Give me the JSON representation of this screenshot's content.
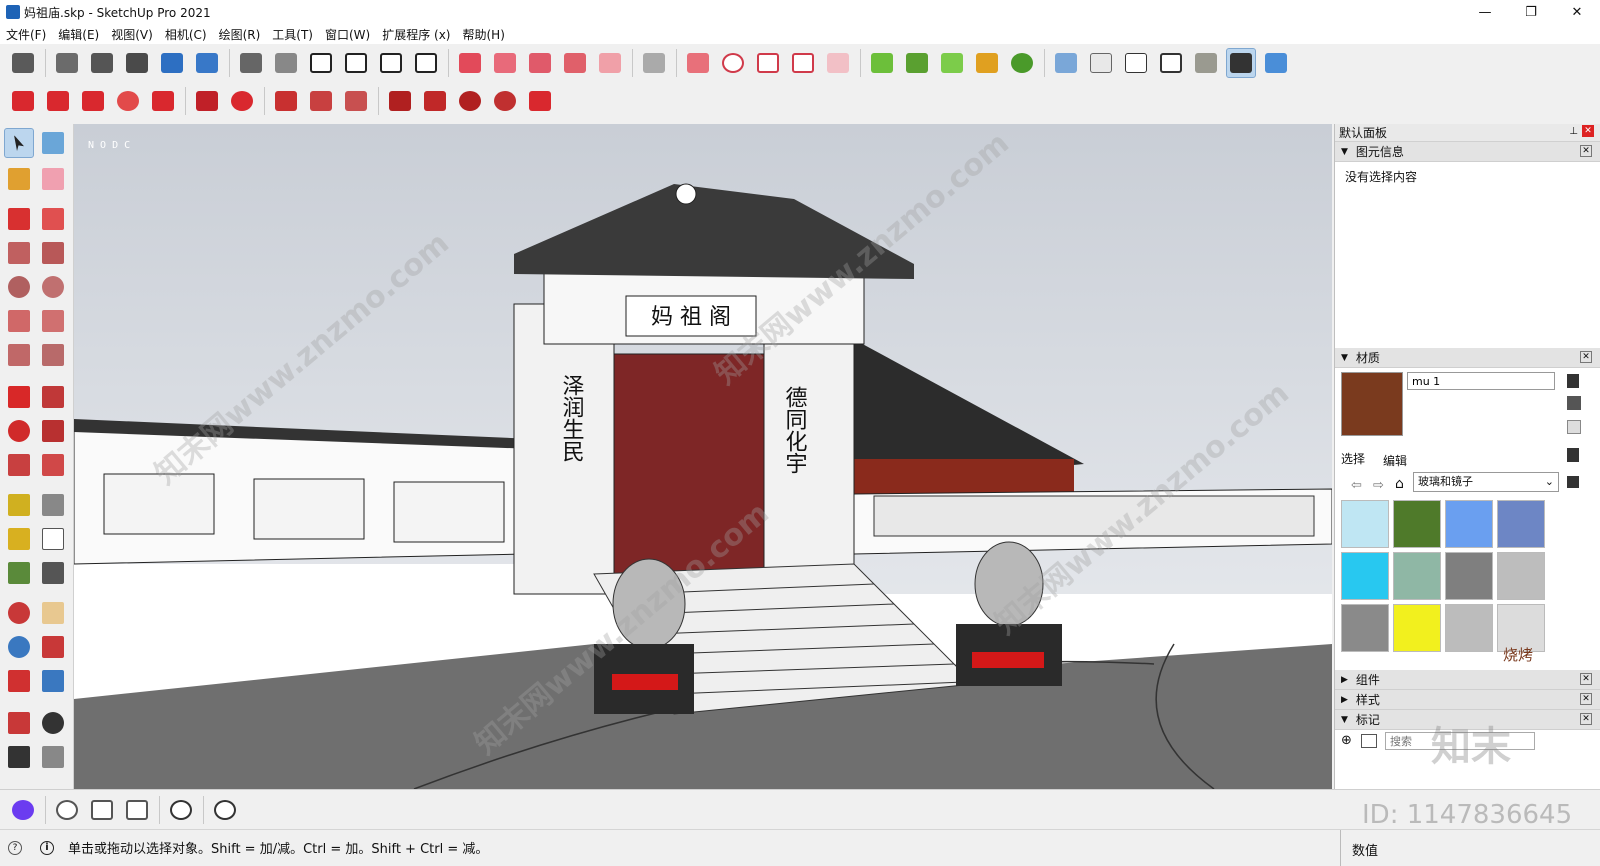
{
  "window": {
    "title": "妈祖庙.skp - SketchUp Pro 2021",
    "minimize": "—",
    "maximize": "❐",
    "close": "✕"
  },
  "menu": [
    "文件(F)",
    "编辑(E)",
    "视图(V)",
    "相机(C)",
    "绘图(R)",
    "工具(T)",
    "窗口(W)",
    "扩展程序 (x)",
    "帮助(H)"
  ],
  "viewport": {
    "corner_label": "N O   D C"
  },
  "scene": {
    "plaque": "妈 祖 阁",
    "left_couplet": "泽润生民",
    "right_couplet": "德同化宇"
  },
  "default_panel": {
    "title": "默认面板",
    "entity_info": {
      "title": "图元信息",
      "empty_text": "没有选择内容"
    },
    "materials": {
      "title": "材质",
      "material_name": "mu 1",
      "current_color": "#7a3a1e",
      "tab_select": "选择",
      "tab_edit": "编辑",
      "library": "玻璃和镜子",
      "swatches": [
        {
          "name": "glass-blue-grid",
          "color": "#bfe6f3"
        },
        {
          "name": "glass-green",
          "color": "#4f7a2a"
        },
        {
          "name": "glass-blue",
          "color": "#6a9ff0"
        },
        {
          "name": "glass-sky",
          "color": "#6d86c5"
        },
        {
          "name": "glass-cyan",
          "color": "#28c8f0"
        },
        {
          "name": "glass-reed",
          "color": "#8fb7a5"
        },
        {
          "name": "glass-block",
          "color": "#7f7f7f"
        },
        {
          "name": "glass-frosted",
          "color": "#bdbdbd"
        },
        {
          "name": "mirror-grey",
          "color": "#8a8a8a"
        },
        {
          "name": "glass-yellow",
          "color": "#f2f01e"
        },
        {
          "name": "mirror-silver",
          "color": "#bcbcbc"
        },
        {
          "name": "mirror-light",
          "color": "#dcdcdc"
        }
      ]
    },
    "components": "组件",
    "styles": "样式",
    "tags": "标记",
    "search_placeholder": "搜索"
  },
  "status": {
    "hint": "单击或拖动以选择对象。Shift = 加/减。Ctrl = 加。Shift + Ctrl = 减。",
    "measurements_label": "数值",
    "watermark_id": "ID: 1147836645"
  },
  "watermark_text": "知末网www.znzmo.com",
  "logo_text": "知末",
  "logo_script": "烧烤"
}
